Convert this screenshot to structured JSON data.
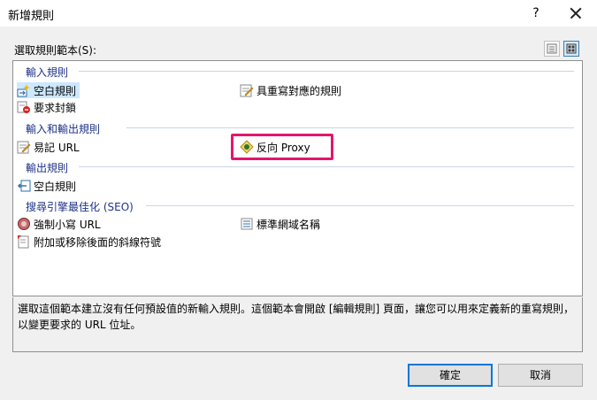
{
  "window": {
    "title": "新增規則",
    "help": "?"
  },
  "templates_label": "選取規則範本(S):",
  "groups": {
    "inbound": {
      "header": "輸入規則",
      "items": [
        "空白規則",
        "具重寫對應的規則",
        "要求封鎖"
      ]
    },
    "inbound_outbound": {
      "header": "輸入和輸出規則",
      "items": [
        "易記 URL",
        "反向 Proxy"
      ]
    },
    "outbound": {
      "header": "輸出規則",
      "items": [
        "空白規則"
      ]
    },
    "seo": {
      "header": "搜尋引擎最佳化 (SEO)",
      "items": [
        "強制小寫 URL",
        "標準網域名稱",
        "附加或移除後面的斜線符號"
      ]
    }
  },
  "description": "選取這個範本建立沒有任何預設值的新輸入規則。這個範本會開啟 [編輯規則] 頁面，讓您可以用來定義新的重寫規則，以變更要求的 URL 位址。",
  "buttons": {
    "ok": "確定",
    "cancel": "取消"
  },
  "highlight_color": "#e4156e",
  "selection_color": "#cde8ff",
  "group_header_color": "#1e3287"
}
